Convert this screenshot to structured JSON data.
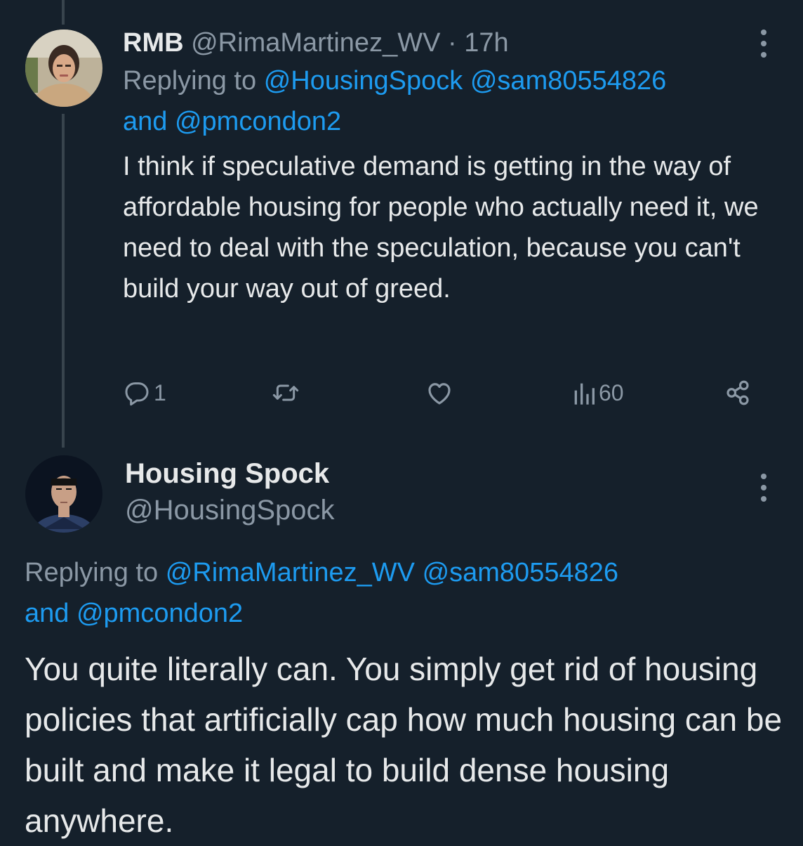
{
  "tweet1": {
    "display_name": "RMB",
    "handle": "@RimaMartinez_WV",
    "separator": "·",
    "time": "17h",
    "replying_prefix": "Replying to",
    "mention_1": "@HousingSpock",
    "mention_2": "@sam80554826",
    "and": "and",
    "mention_3": "@pmcondon2",
    "text": "I think if speculative demand is getting in the way of affordable housing for people who actually need it, we need to deal with the speculation, because you can't build your way out of greed.",
    "reply_count": "1",
    "views": "60",
    "icons": [
      "reply-icon",
      "retweet-icon",
      "like-icon",
      "views-icon",
      "share-icon",
      "more-icon"
    ]
  },
  "tweet2": {
    "display_name": "Housing Spock",
    "handle": "@HousingSpock",
    "replying_prefix": "Replying to",
    "mention_1": "@RimaMartinez_WV",
    "mention_2": "@sam80554826",
    "and": "and",
    "mention_3": "@pmcondon2",
    "text": "You quite literally can. You simply get rid of housing policies that artificially cap how much housing can be built and make it legal to build dense housing anywhere.",
    "icons": [
      "more-icon"
    ]
  },
  "colors": {
    "background": "#15202b",
    "text": "#e7e9ea",
    "muted": "#8b98a5",
    "link": "#1d9bf0",
    "thread_line": "#38444d"
  }
}
